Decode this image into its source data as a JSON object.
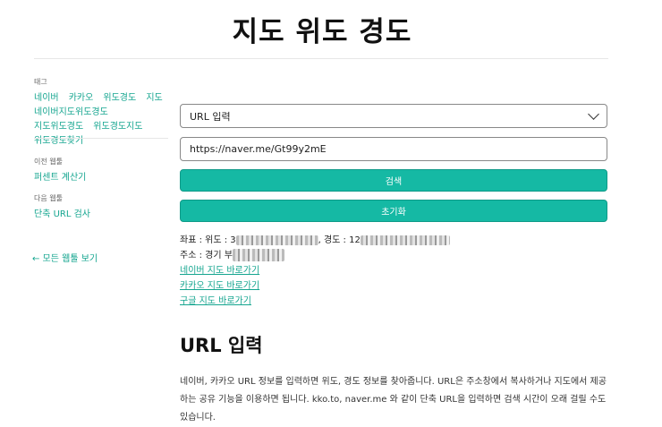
{
  "header": {
    "title": "지도 위도 경도"
  },
  "sidebar": {
    "tags_label": "태그",
    "tags": [
      "네이버",
      "카카오",
      "위도경도",
      "지도",
      "네이버지도위도경도",
      "지도위도경도",
      "위도경도지도",
      "위도경도찾기"
    ],
    "prev_label": "이전 웹툴",
    "prev_link": "퍼센트 계산기",
    "next_label": "다음 웹툴",
    "next_link": "단축 URL 검사",
    "all_apps": "← 모든 웹툴 보기"
  },
  "form": {
    "select_value": "URL 입력",
    "url_value": "https://naver.me/Gt99y2mE",
    "search_button": "검색",
    "reset_button": "초기화"
  },
  "result": {
    "coord_prefix": "좌표 : 위도 : 3",
    "coord_mid": ", 경도 : 12",
    "address_prefix": "주소 : 경기 부",
    "links": [
      "네이버 지도 바로가기",
      "카카오 지도 바로가기",
      "구글 지도 바로가기"
    ]
  },
  "section": {
    "heading": "URL 입력",
    "description": "네이버, 카카오 URL 정보를 입력하면 위도, 경도 정보를 찾아줍니다. URL은 주소창에서 복사하거나 지도에서 제공하는 공유 기능을 이용하면 됩니다. kko.to, naver.me 와 같이 단축 URL을 입력하면 검색 시간이 오래 걸릴 수도 있습니다."
  }
}
